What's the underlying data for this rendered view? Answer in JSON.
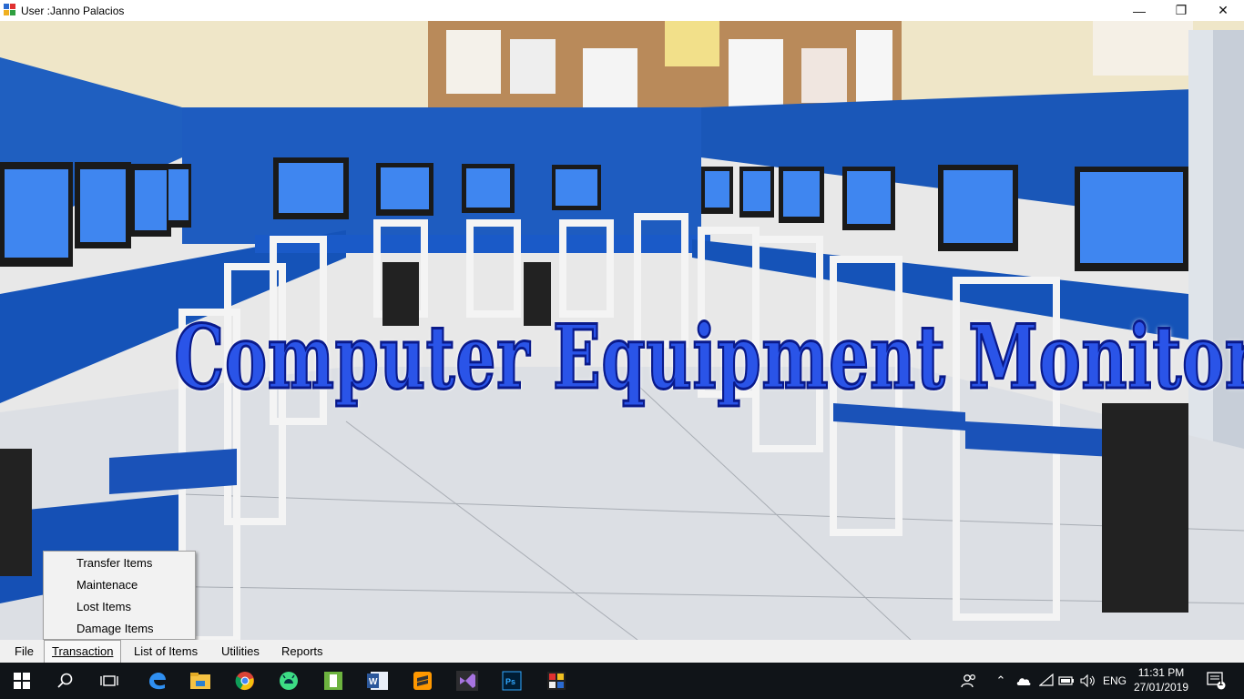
{
  "window": {
    "title": "User :Janno Palacios",
    "minimize": "—",
    "maximize": "❐",
    "close": "✕"
  },
  "banner": {
    "title": "Computer Equipment Monitoring System"
  },
  "menubar": {
    "items": [
      "File",
      "Transaction",
      "List of Items",
      "Utilities",
      "Reports"
    ]
  },
  "dropdown": {
    "items": [
      "Transfer Items",
      "Maintenace",
      "Lost Items",
      "Damage Items"
    ]
  },
  "taskbar": {
    "language": "ENG",
    "time": "11:31 PM",
    "date": "27/01/2019",
    "notification_count": "1",
    "apps": [
      "windows-start",
      "search",
      "task-view",
      "edge",
      "file-explorer",
      "chrome",
      "android-studio",
      "app-green",
      "word",
      "sublime-text",
      "visual-studio",
      "photoshop",
      "app-color"
    ]
  },
  "colors": {
    "title_fill": "#2a54e8",
    "title_stroke": "#0a1a8a",
    "taskbar_bg": "#101418",
    "menubar_bg": "#f0f0f0"
  }
}
